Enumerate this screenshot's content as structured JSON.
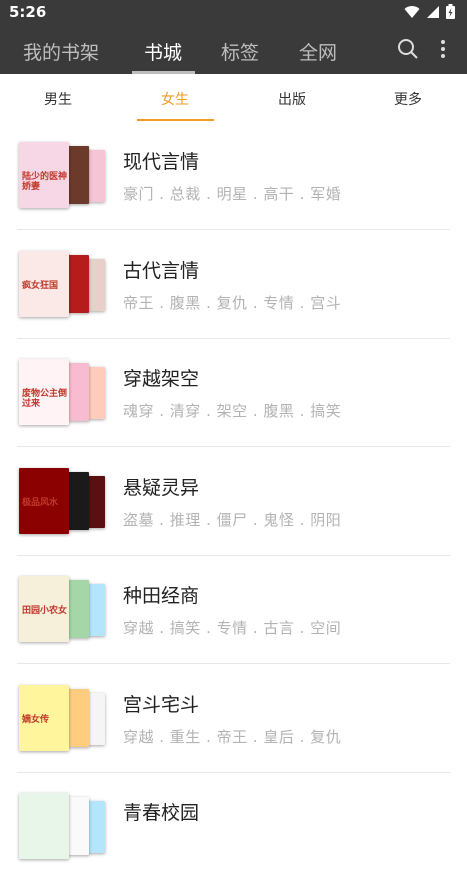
{
  "status": {
    "time": "5:26"
  },
  "main_tabs": [
    {
      "label": "我的书架",
      "active": false
    },
    {
      "label": "书城",
      "active": true
    },
    {
      "label": "标签",
      "active": false
    },
    {
      "label": "全网",
      "active": false
    }
  ],
  "sub_tabs": [
    {
      "label": "男生",
      "active": false
    },
    {
      "label": "女生",
      "active": true
    },
    {
      "label": "出版",
      "active": false
    },
    {
      "label": "更多",
      "active": false
    }
  ],
  "categories": [
    {
      "title": "现代言情",
      "tags": "豪门 . 总裁 . 明星 . 高干 . 军婚",
      "cover_text": "陆少的医神娇妻",
      "colors": [
        "#f7d6e6",
        "#6b3a2a",
        "#f5c5d5"
      ]
    },
    {
      "title": "古代言情",
      "tags": "帝王 . 腹黑 . 复仇 . 专情 . 宫斗",
      "cover_text": "疯女狂国",
      "colors": [
        "#fbe9e7",
        "#b71c1c",
        "#e8d0c8"
      ]
    },
    {
      "title": "穿越架空",
      "tags": "魂穿 . 清穿 . 架空 . 腹黑 . 搞笑",
      "cover_text": "废物公主倒过来",
      "colors": [
        "#fff3f5",
        "#f8bbd0",
        "#ffccbc"
      ]
    },
    {
      "title": "悬疑灵异",
      "tags": "盗墓 . 推理 . 僵尸 . 鬼怪 . 阴阳",
      "cover_text": "极品风水",
      "colors": [
        "#8b0000",
        "#1a1a1a",
        "#5a1010"
      ]
    },
    {
      "title": "种田经商",
      "tags": "穿越 . 搞笑 . 专情 . 古言 . 空间",
      "cover_text": "田园小农女",
      "colors": [
        "#f6efd9",
        "#a5d6a7",
        "#b3e5fc"
      ]
    },
    {
      "title": "宫斗宅斗",
      "tags": "穿越 . 重生 . 帝王 . 皇后 . 复仇",
      "cover_text": "嫡女传",
      "colors": [
        "#fff59d",
        "#ffcc80",
        "#f5f5f5"
      ]
    },
    {
      "title": "青春校园",
      "tags": "",
      "cover_text": "",
      "colors": [
        "#e8f5e9",
        "#fafafa",
        "#b3e5fc"
      ]
    }
  ]
}
